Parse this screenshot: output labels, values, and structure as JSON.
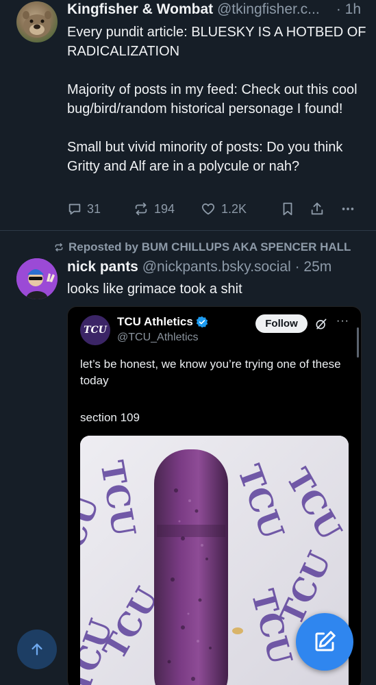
{
  "post1": {
    "author_name": "Kingfisher & Wombat",
    "handle": "@tkingfisher.c...",
    "time": "· 1h",
    "text": "Every pundit article: BLUESKY IS A HOTBED OF RADICALIZATION\n\nMajority of posts in my feed: Check out this cool bug/bird/random historical personage I found!\n\nSmall but vivid minority of posts: Do you think Gritty and Alf are in a polycule or nah?",
    "replies": "31",
    "reposts": "194",
    "likes": "1.2K"
  },
  "post2": {
    "repost_label": "Reposted by BUM CHILLUPS AKA SPENCER HALL",
    "author_name": "nick pants",
    "handle": "@nickpants.bsky.social",
    "time": "· 25m",
    "text": "looks like grimace took a shit"
  },
  "embed": {
    "logo_text": "TCU",
    "name": "TCU Athletics",
    "handle": "@TCU_Athletics",
    "follow_label": "Follow",
    "more_label": "···",
    "text1": "let’s be honest, we know you’re trying one of these today",
    "text2": "section 109",
    "wrapper_text": "TCU"
  },
  "colors": {
    "background": "#161e27",
    "accent": "#2f86ef",
    "muted": "#8d9aa8"
  },
  "icons": [
    "reply-icon",
    "repost-icon",
    "heart-icon",
    "bookmark-icon",
    "share-icon",
    "more-icon",
    "verified-icon",
    "grok-icon",
    "compose-icon",
    "arrow-up-icon"
  ]
}
